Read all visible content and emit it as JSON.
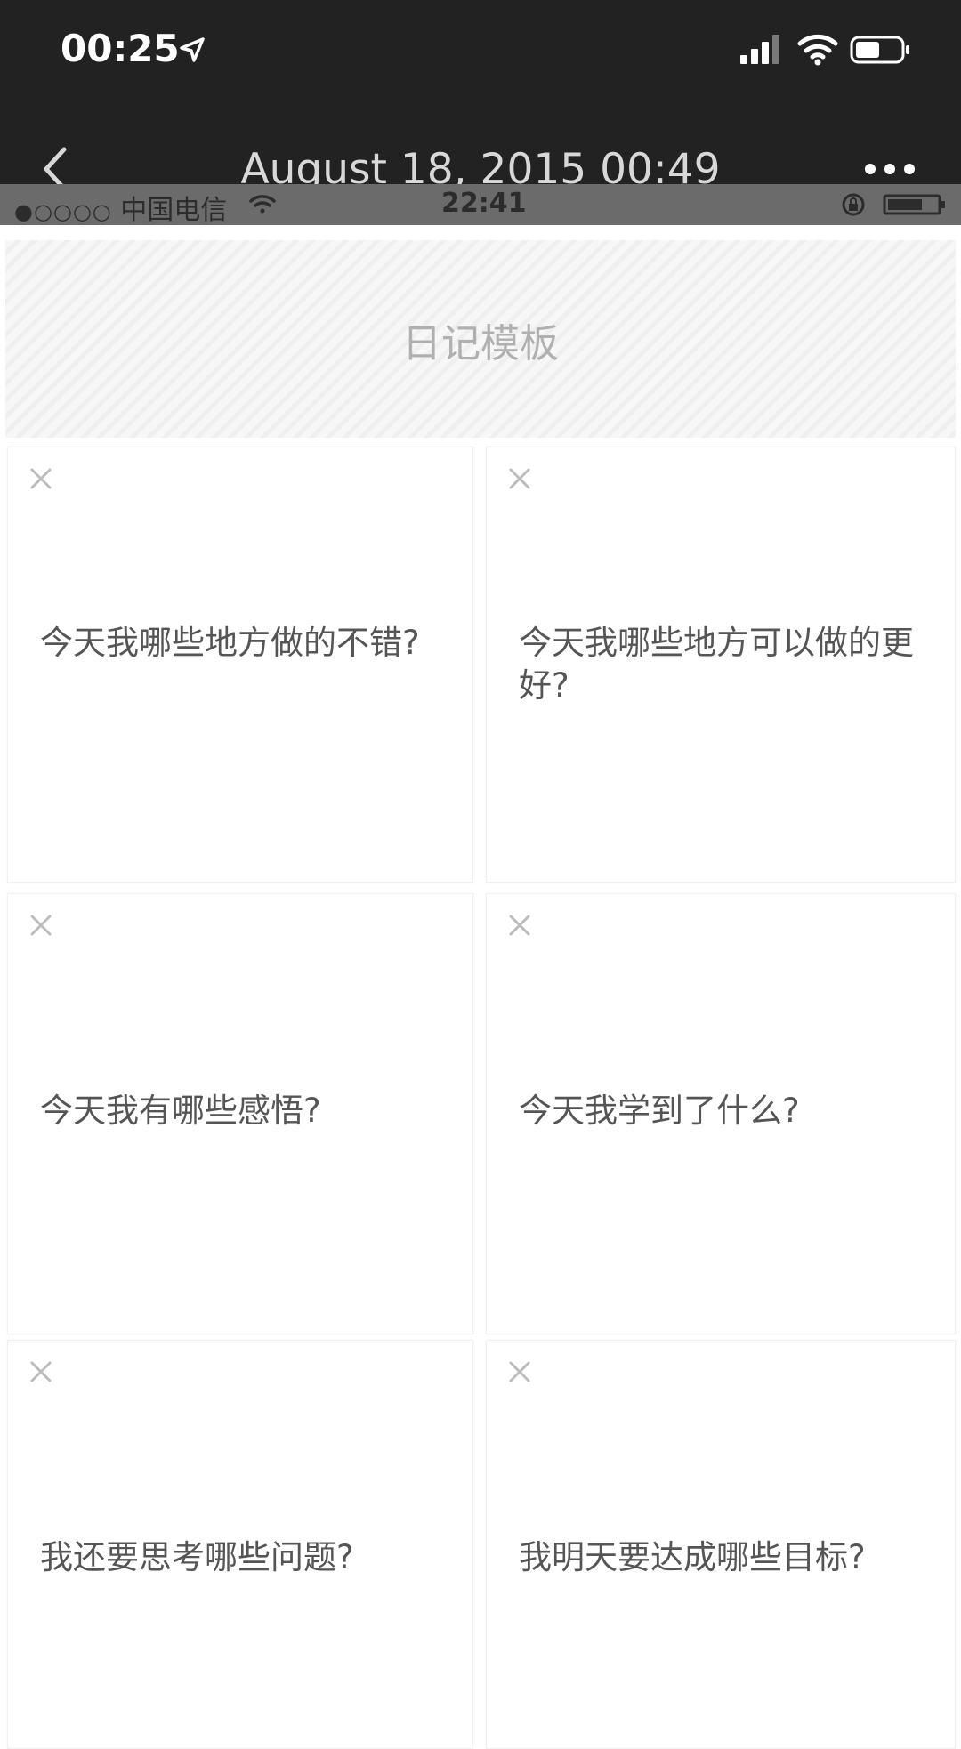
{
  "status_bar": {
    "time": "00:25",
    "location_icon": "location-arrow-icon",
    "signal_icon": "cellular-signal-icon",
    "wifi_icon": "wifi-icon",
    "battery_icon": "battery-icon"
  },
  "nav": {
    "title": "August 18, 2015 00:49",
    "back_icon": "chevron-left-icon",
    "more_icon": "more-horizontal-icon"
  },
  "embedded_status": {
    "carrier": "中国电信",
    "signal_dots": "●○○○○",
    "time": "22:41"
  },
  "template": {
    "title": "日记模板"
  },
  "cards": [
    {
      "question": "今天我哪些地方做的不错?"
    },
    {
      "question": "今天我哪些地方可以做的更好?"
    },
    {
      "question": "今天我有哪些感悟?"
    },
    {
      "question": "今天我学到了什么?"
    },
    {
      "question": "我还要思考哪些问题?"
    },
    {
      "question": "我明天要达成哪些目标?"
    }
  ],
  "colors": {
    "header_bg": "#222222",
    "embedded_status_bg": "#6b6b6b",
    "card_text": "#555555",
    "banner_text": "#b0b0b0"
  }
}
